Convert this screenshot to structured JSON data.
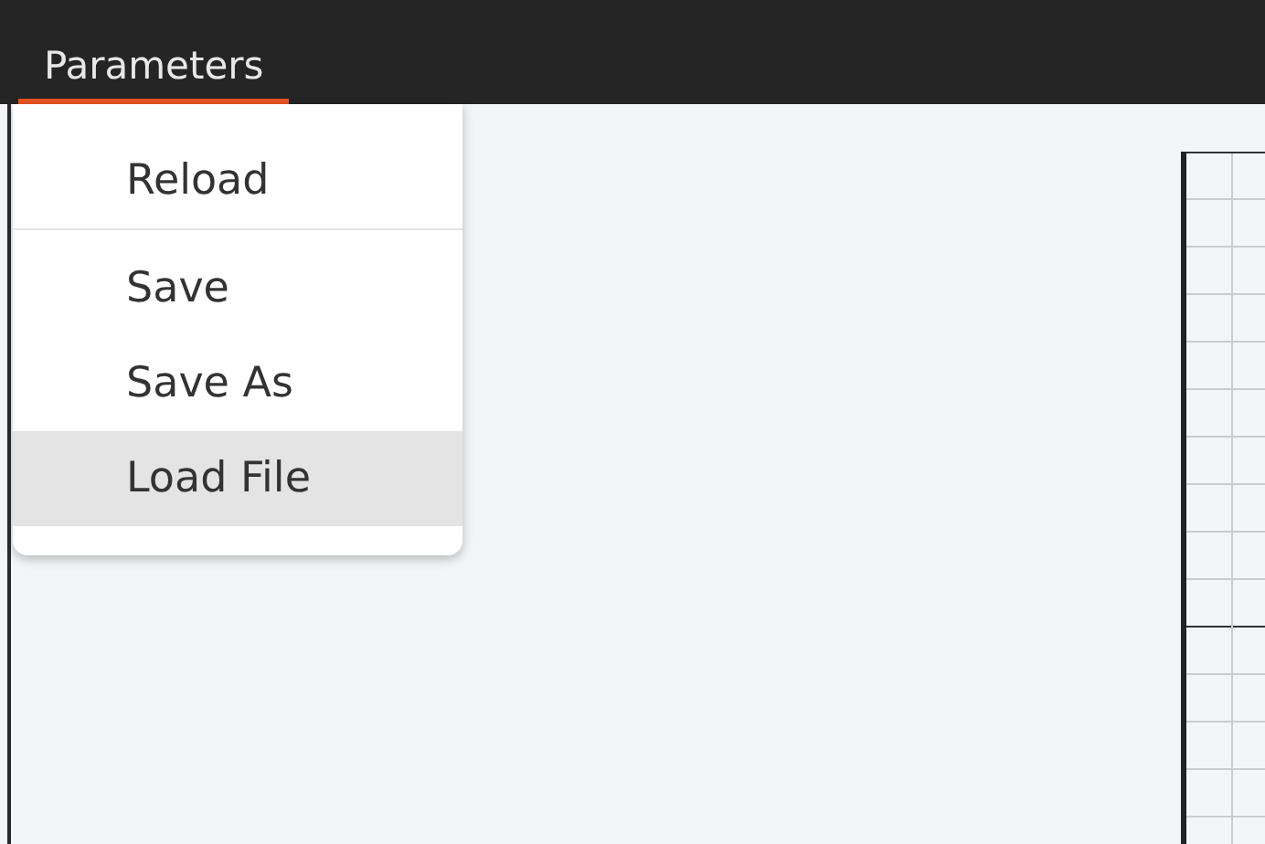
{
  "menubar": {
    "title": "Parameters",
    "open": true
  },
  "menu": {
    "items": [
      {
        "kind": "item",
        "label": "Reload",
        "selected": false
      },
      {
        "kind": "separator"
      },
      {
        "kind": "item",
        "label": "Save",
        "selected": false
      },
      {
        "kind": "item",
        "label": "Save As",
        "selected": false
      },
      {
        "kind": "item",
        "label": "Load File",
        "selected": true
      }
    ]
  }
}
